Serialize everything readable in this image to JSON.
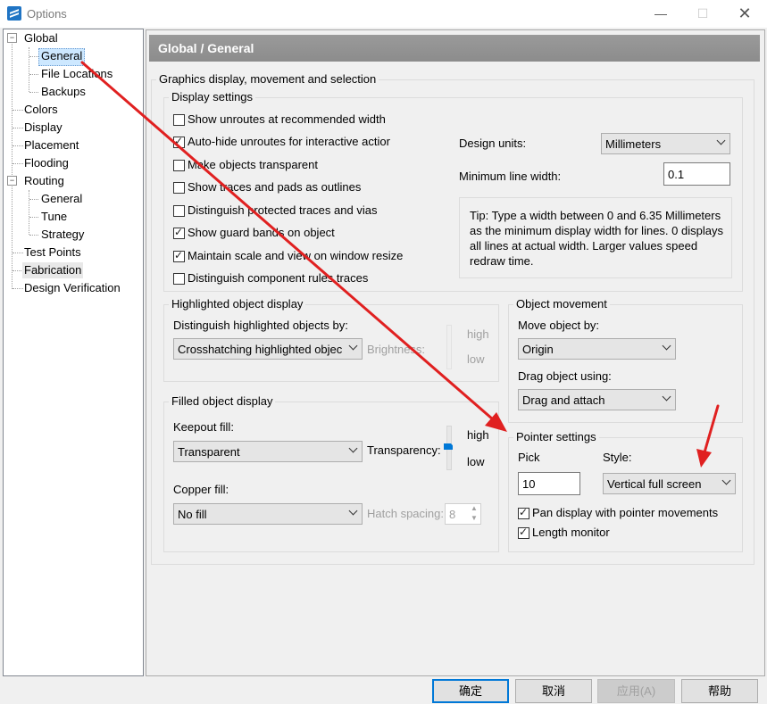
{
  "window": {
    "title": "Options"
  },
  "tree": [
    {
      "label": "Global"
    },
    {
      "label": "General"
    },
    {
      "label": "File Locations"
    },
    {
      "label": "Backups"
    },
    {
      "label": "Colors"
    },
    {
      "label": "Display"
    },
    {
      "label": "Placement"
    },
    {
      "label": "Flooding"
    },
    {
      "label": "Routing"
    },
    {
      "label": "General"
    },
    {
      "label": "Tune"
    },
    {
      "label": "Strategy"
    },
    {
      "label": "Test Points"
    },
    {
      "label": "Fabrication"
    },
    {
      "label": "Design Verification"
    }
  ],
  "panel": {
    "header": "Global / General",
    "section_title": "Graphics display, movement and selection",
    "display_settings": {
      "title": "Display settings",
      "checkboxes": [
        {
          "label": "Show unroutes at recommended width",
          "checked": false
        },
        {
          "label": "Auto-hide unroutes for interactive actior",
          "checked": true
        },
        {
          "label": "Make objects transparent",
          "checked": false
        },
        {
          "label": "Show traces and pads as outlines",
          "checked": false
        },
        {
          "label": "Distinguish protected traces and vias",
          "checked": false
        },
        {
          "label": "Show guard bands on object",
          "checked": true
        },
        {
          "label": "Maintain scale and view on window resize",
          "checked": true
        },
        {
          "label": "Distinguish component rules traces",
          "checked": false
        }
      ],
      "design_units_label": "Design units:",
      "design_units_value": "Millimeters",
      "min_line_width_label": "Minimum line width:",
      "min_line_width_value": "0.1",
      "tip": "Tip: Type a width between 0 and 6.35 Millimeters as the minimum display width for lines. 0 displays all lines at actual width. Larger values speed redraw time."
    },
    "highlighted": {
      "title": "Highlighted object display",
      "distinguish_label": "Distinguish highlighted objects by:",
      "distinguish_value": "Crosshatching highlighted objec",
      "brightness_label": "Brightness:",
      "high": "high",
      "low": "low"
    },
    "object_movement": {
      "title": "Object movement",
      "move_label": "Move object by:",
      "move_value": "Origin",
      "drag_label": "Drag object using:",
      "drag_value": "Drag and attach"
    },
    "filled": {
      "title": "Filled object display",
      "keepout_label": "Keepout fill:",
      "keepout_value": "Transparent",
      "transparency_label": "Transparency:",
      "high": "high",
      "low": "low",
      "copper_label": "Copper fill:",
      "copper_value": "No fill",
      "hatch_label": "Hatch spacing:",
      "hatch_value": "8"
    },
    "pointer": {
      "title": "Pointer settings",
      "pick_label": "Pick",
      "pick_value": "10",
      "style_label": "Style:",
      "style_value": "Vertical full screen",
      "pan_label": "Pan display with pointer movements",
      "pan_checked": true,
      "length_label": "Length monitor",
      "length_checked": true
    }
  },
  "footer": {
    "ok": "确定",
    "cancel": "取消",
    "apply": "应用(A)",
    "help": "帮助"
  },
  "colors": {
    "arrow": "#e02020",
    "selection": "#cde8ff",
    "header": "#959595"
  }
}
